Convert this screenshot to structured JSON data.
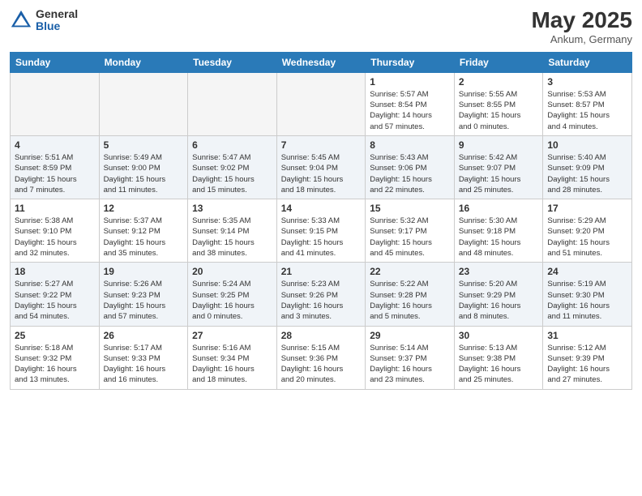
{
  "header": {
    "logo_general": "General",
    "logo_blue": "Blue",
    "month": "May 2025",
    "location": "Ankum, Germany"
  },
  "days_of_week": [
    "Sunday",
    "Monday",
    "Tuesday",
    "Wednesday",
    "Thursday",
    "Friday",
    "Saturday"
  ],
  "weeks": [
    [
      {
        "day": "",
        "info": ""
      },
      {
        "day": "",
        "info": ""
      },
      {
        "day": "",
        "info": ""
      },
      {
        "day": "",
        "info": ""
      },
      {
        "day": "1",
        "info": "Sunrise: 5:57 AM\nSunset: 8:54 PM\nDaylight: 14 hours\nand 57 minutes."
      },
      {
        "day": "2",
        "info": "Sunrise: 5:55 AM\nSunset: 8:55 PM\nDaylight: 15 hours\nand 0 minutes."
      },
      {
        "day": "3",
        "info": "Sunrise: 5:53 AM\nSunset: 8:57 PM\nDaylight: 15 hours\nand 4 minutes."
      }
    ],
    [
      {
        "day": "4",
        "info": "Sunrise: 5:51 AM\nSunset: 8:59 PM\nDaylight: 15 hours\nand 7 minutes."
      },
      {
        "day": "5",
        "info": "Sunrise: 5:49 AM\nSunset: 9:00 PM\nDaylight: 15 hours\nand 11 minutes."
      },
      {
        "day": "6",
        "info": "Sunrise: 5:47 AM\nSunset: 9:02 PM\nDaylight: 15 hours\nand 15 minutes."
      },
      {
        "day": "7",
        "info": "Sunrise: 5:45 AM\nSunset: 9:04 PM\nDaylight: 15 hours\nand 18 minutes."
      },
      {
        "day": "8",
        "info": "Sunrise: 5:43 AM\nSunset: 9:06 PM\nDaylight: 15 hours\nand 22 minutes."
      },
      {
        "day": "9",
        "info": "Sunrise: 5:42 AM\nSunset: 9:07 PM\nDaylight: 15 hours\nand 25 minutes."
      },
      {
        "day": "10",
        "info": "Sunrise: 5:40 AM\nSunset: 9:09 PM\nDaylight: 15 hours\nand 28 minutes."
      }
    ],
    [
      {
        "day": "11",
        "info": "Sunrise: 5:38 AM\nSunset: 9:10 PM\nDaylight: 15 hours\nand 32 minutes."
      },
      {
        "day": "12",
        "info": "Sunrise: 5:37 AM\nSunset: 9:12 PM\nDaylight: 15 hours\nand 35 minutes."
      },
      {
        "day": "13",
        "info": "Sunrise: 5:35 AM\nSunset: 9:14 PM\nDaylight: 15 hours\nand 38 minutes."
      },
      {
        "day": "14",
        "info": "Sunrise: 5:33 AM\nSunset: 9:15 PM\nDaylight: 15 hours\nand 41 minutes."
      },
      {
        "day": "15",
        "info": "Sunrise: 5:32 AM\nSunset: 9:17 PM\nDaylight: 15 hours\nand 45 minutes."
      },
      {
        "day": "16",
        "info": "Sunrise: 5:30 AM\nSunset: 9:18 PM\nDaylight: 15 hours\nand 48 minutes."
      },
      {
        "day": "17",
        "info": "Sunrise: 5:29 AM\nSunset: 9:20 PM\nDaylight: 15 hours\nand 51 minutes."
      }
    ],
    [
      {
        "day": "18",
        "info": "Sunrise: 5:27 AM\nSunset: 9:22 PM\nDaylight: 15 hours\nand 54 minutes."
      },
      {
        "day": "19",
        "info": "Sunrise: 5:26 AM\nSunset: 9:23 PM\nDaylight: 15 hours\nand 57 minutes."
      },
      {
        "day": "20",
        "info": "Sunrise: 5:24 AM\nSunset: 9:25 PM\nDaylight: 16 hours\nand 0 minutes."
      },
      {
        "day": "21",
        "info": "Sunrise: 5:23 AM\nSunset: 9:26 PM\nDaylight: 16 hours\nand 3 minutes."
      },
      {
        "day": "22",
        "info": "Sunrise: 5:22 AM\nSunset: 9:28 PM\nDaylight: 16 hours\nand 5 minutes."
      },
      {
        "day": "23",
        "info": "Sunrise: 5:20 AM\nSunset: 9:29 PM\nDaylight: 16 hours\nand 8 minutes."
      },
      {
        "day": "24",
        "info": "Sunrise: 5:19 AM\nSunset: 9:30 PM\nDaylight: 16 hours\nand 11 minutes."
      }
    ],
    [
      {
        "day": "25",
        "info": "Sunrise: 5:18 AM\nSunset: 9:32 PM\nDaylight: 16 hours\nand 13 minutes."
      },
      {
        "day": "26",
        "info": "Sunrise: 5:17 AM\nSunset: 9:33 PM\nDaylight: 16 hours\nand 16 minutes."
      },
      {
        "day": "27",
        "info": "Sunrise: 5:16 AM\nSunset: 9:34 PM\nDaylight: 16 hours\nand 18 minutes."
      },
      {
        "day": "28",
        "info": "Sunrise: 5:15 AM\nSunset: 9:36 PM\nDaylight: 16 hours\nand 20 minutes."
      },
      {
        "day": "29",
        "info": "Sunrise: 5:14 AM\nSunset: 9:37 PM\nDaylight: 16 hours\nand 23 minutes."
      },
      {
        "day": "30",
        "info": "Sunrise: 5:13 AM\nSunset: 9:38 PM\nDaylight: 16 hours\nand 25 minutes."
      },
      {
        "day": "31",
        "info": "Sunrise: 5:12 AM\nSunset: 9:39 PM\nDaylight: 16 hours\nand 27 minutes."
      }
    ]
  ]
}
